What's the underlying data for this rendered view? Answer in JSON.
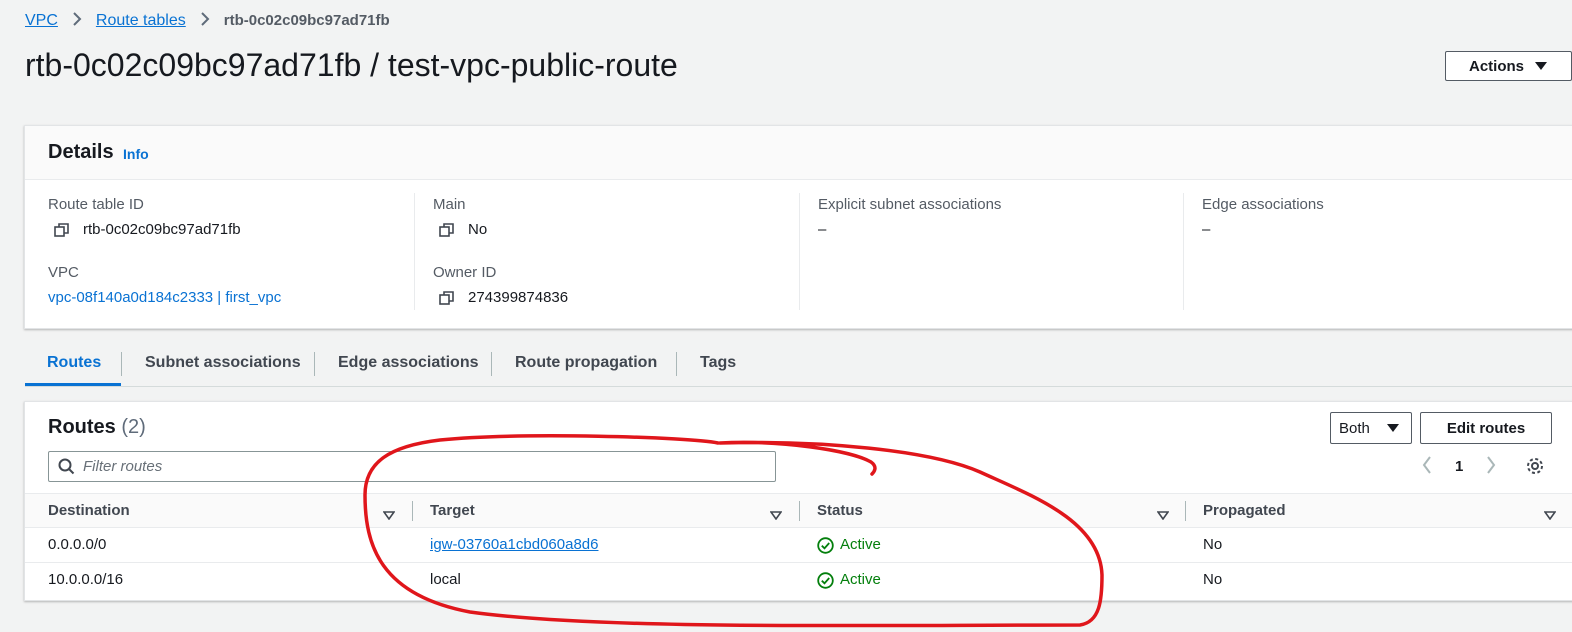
{
  "breadcrumb": {
    "items": [
      "VPC",
      "Route tables"
    ],
    "current": "rtb-0c02c09bc97ad71fb"
  },
  "header": {
    "title": "rtb-0c02c09bc97ad71fb / test-vpc-public-route",
    "actions_label": "Actions"
  },
  "details": {
    "title": "Details",
    "info_label": "Info",
    "fields": {
      "route_table_id": {
        "label": "Route table ID",
        "value": "rtb-0c02c09bc97ad71fb"
      },
      "main": {
        "label": "Main",
        "value": "No"
      },
      "explicit_subnet": {
        "label": "Explicit subnet associations",
        "value": "–"
      },
      "edge": {
        "label": "Edge associations",
        "value": "–"
      },
      "vpc": {
        "label": "VPC",
        "value": "vpc-08f140a0d184c2333 | first_vpc"
      },
      "owner": {
        "label": "Owner ID",
        "value": "274399874836"
      }
    }
  },
  "tabs": [
    "Routes",
    "Subnet associations",
    "Edge associations",
    "Route propagation",
    "Tags"
  ],
  "routes": {
    "title": "Routes",
    "count": "(2)",
    "filter_placeholder": "Filter routes",
    "both_label": "Both",
    "edit_label": "Edit routes",
    "page": "1",
    "columns": [
      "Destination",
      "Target",
      "Status",
      "Propagated"
    ],
    "rows": [
      {
        "destination": "0.0.0.0/0",
        "target": "igw-03760a1cbd060a8d6",
        "status": "Active",
        "propagated": "No"
      },
      {
        "destination": "10.0.0.0/16",
        "target": "local",
        "status": "Active",
        "propagated": "No"
      }
    ]
  },
  "colors": {
    "link": "#0972d3",
    "status_active": "#037f0c",
    "annotation": "#e0161b"
  }
}
